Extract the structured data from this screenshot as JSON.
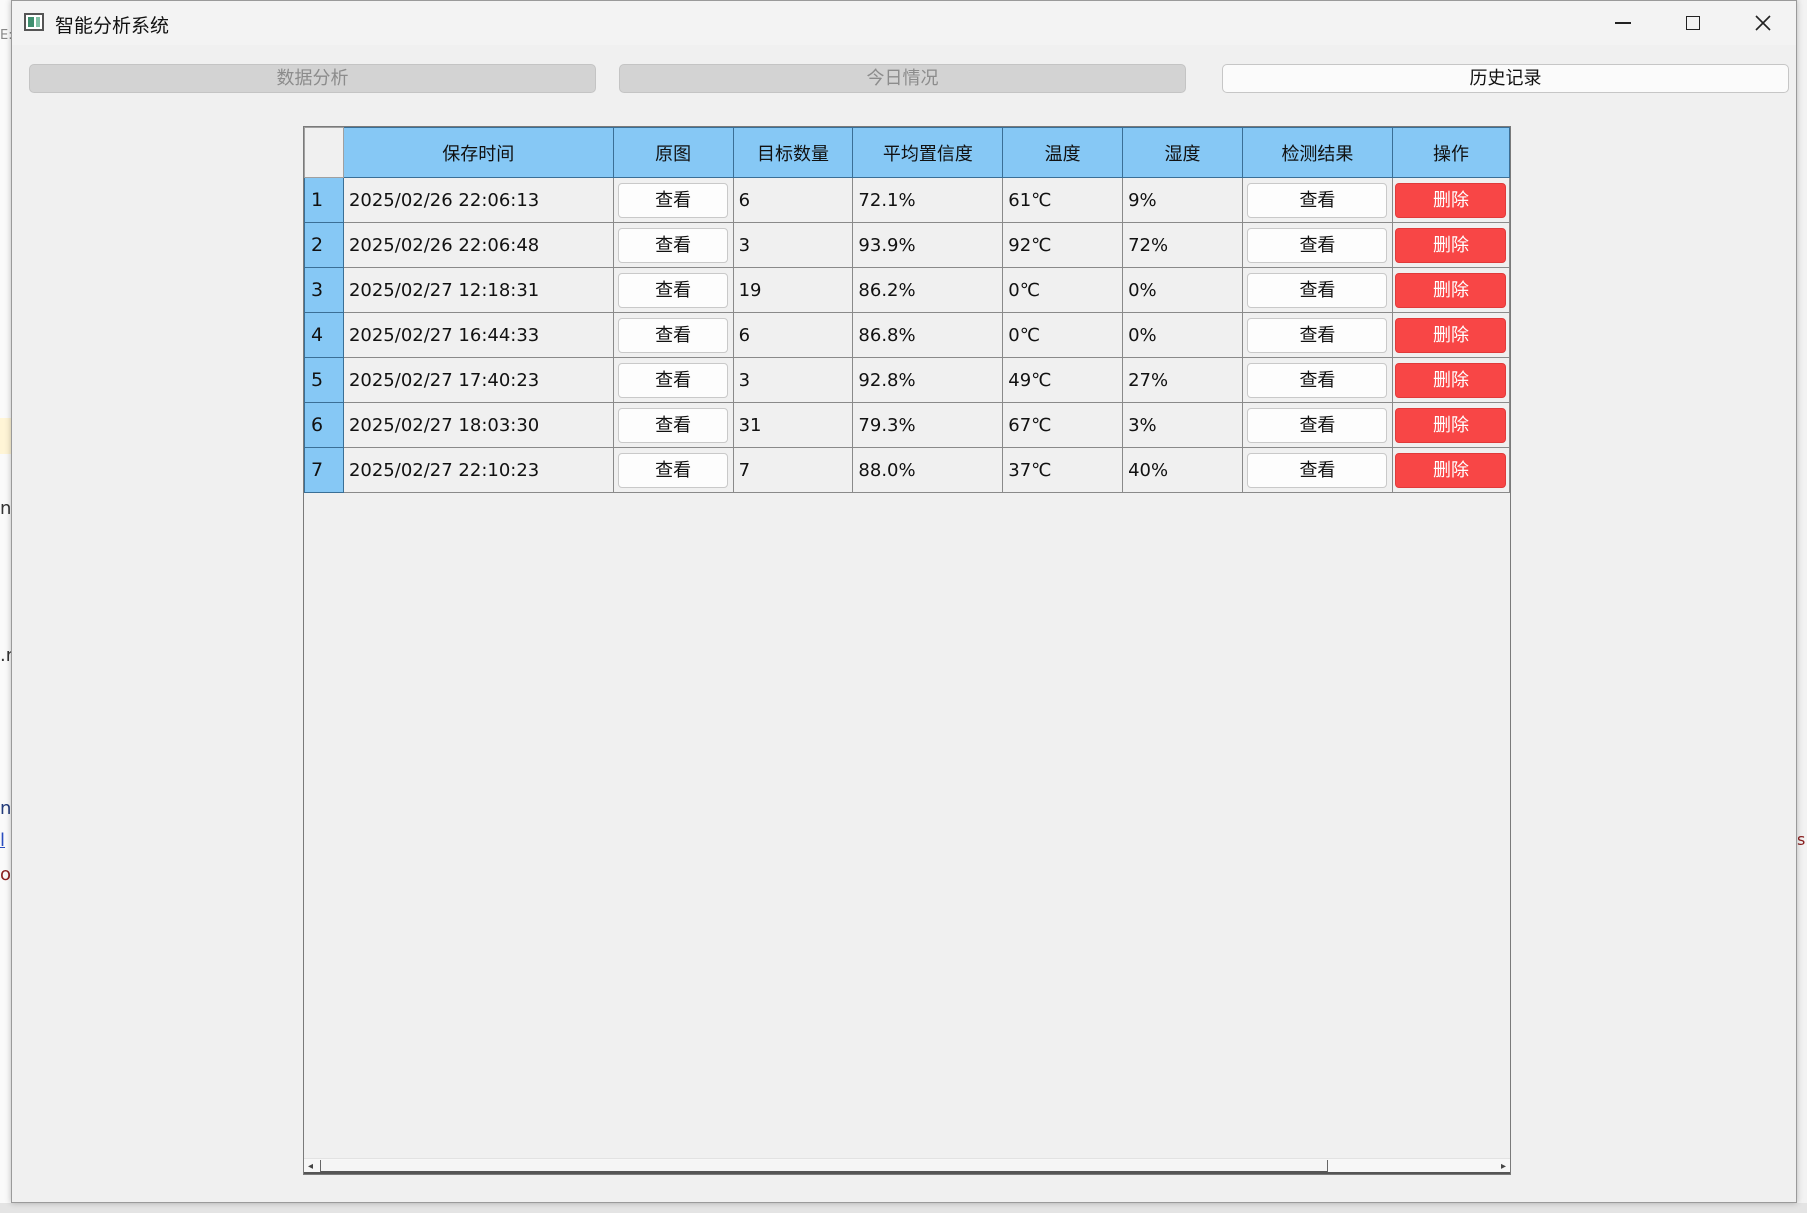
{
  "window": {
    "title": "智能分析系统"
  },
  "background_fragments": [
    "E:",
    "nf",
    ".n",
    "n",
    "l",
    "o",
    "s"
  ],
  "tabs": [
    {
      "label": "数据分析",
      "state": "disabled"
    },
    {
      "label": "今日情况",
      "state": "disabled"
    },
    {
      "label": "历史记录",
      "state": "active"
    }
  ],
  "table": {
    "headers": [
      "保存时间",
      "原图",
      "目标数量",
      "平均置信度",
      "温度",
      "湿度",
      "检测结果",
      "操作"
    ],
    "view_label": "查看",
    "delete_label": "删除",
    "header_color": "#86c8f5",
    "delete_color": "#f84646",
    "rows": [
      {
        "index": "1",
        "time": "2025/02/26 22:06:13",
        "count": "6",
        "confidence": "72.1%",
        "temperature": "61℃",
        "humidity": "9%"
      },
      {
        "index": "2",
        "time": "2025/02/26 22:06:48",
        "count": "3",
        "confidence": "93.9%",
        "temperature": "92℃",
        "humidity": "72%"
      },
      {
        "index": "3",
        "time": "2025/02/27 12:18:31",
        "count": "19",
        "confidence": "86.2%",
        "temperature": "0℃",
        "humidity": "0%"
      },
      {
        "index": "4",
        "time": "2025/02/27 16:44:33",
        "count": "6",
        "confidence": "86.8%",
        "temperature": "0℃",
        "humidity": "0%"
      },
      {
        "index": "5",
        "time": "2025/02/27 17:40:23",
        "count": "3",
        "confidence": "92.8%",
        "temperature": "49℃",
        "humidity": "27%"
      },
      {
        "index": "6",
        "time": "2025/02/27 18:03:30",
        "count": "31",
        "confidence": "79.3%",
        "temperature": "67℃",
        "humidity": "3%"
      },
      {
        "index": "7",
        "time": "2025/02/27 22:10:23",
        "count": "7",
        "confidence": "88.0%",
        "temperature": "37℃",
        "humidity": "40%"
      }
    ]
  }
}
